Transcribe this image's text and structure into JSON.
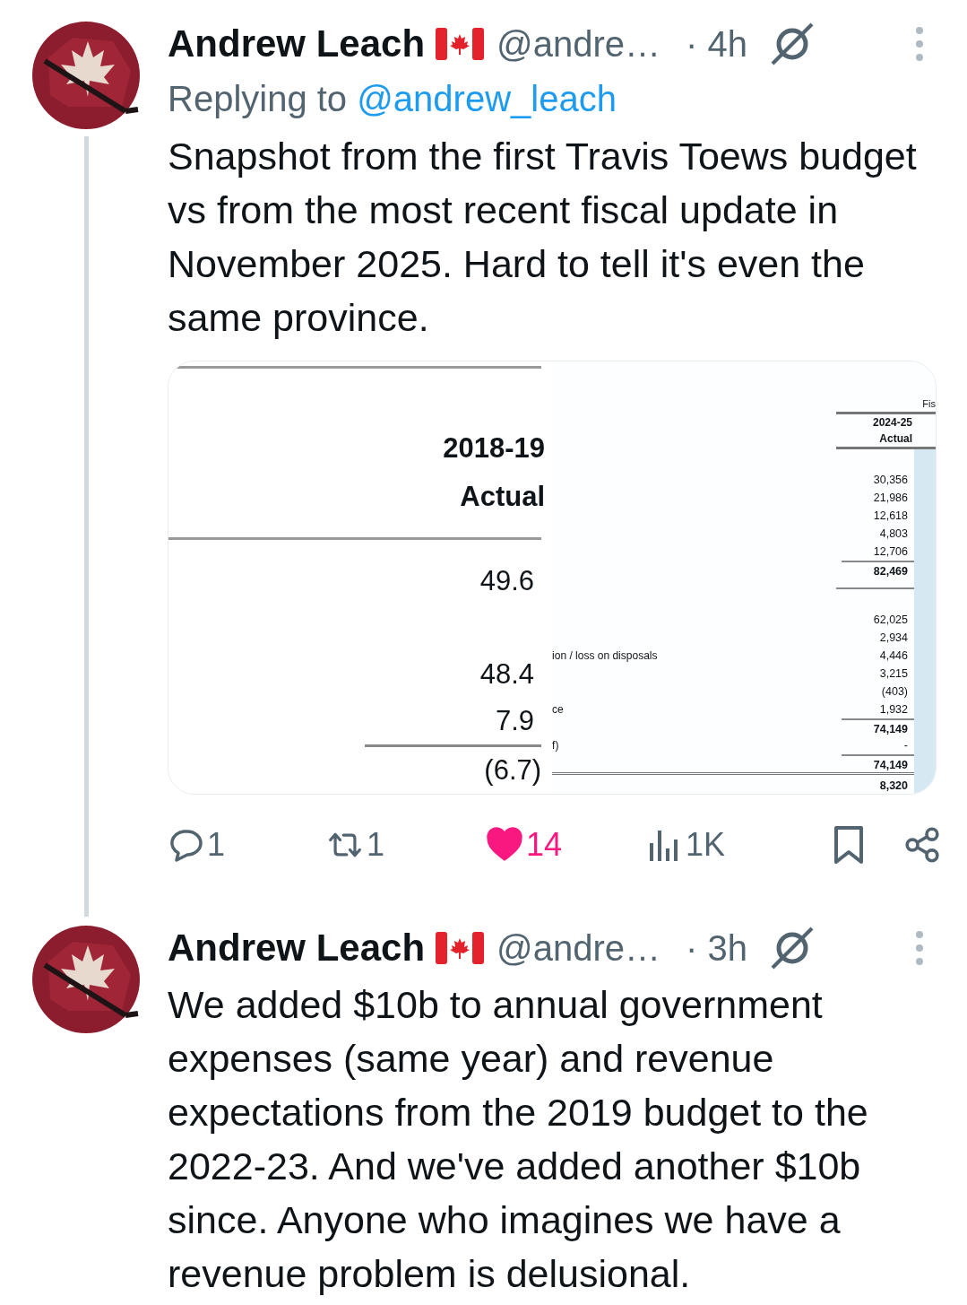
{
  "tweets": [
    {
      "author": "Andrew Leach",
      "handle": "@andre…",
      "time": "· 4h",
      "reply_prefix": "Replying to",
      "reply_handle": "@andrew_leach",
      "text": "Snapshot from the first Travis Toews budget vs from the most recent fiscal update in November 2025. Hard to tell it's even the same province.",
      "media": {
        "left": {
          "header": [
            "2018-19",
            "Actual"
          ],
          "values": [
            {
              "value": "49.6",
              "kind": "value"
            },
            {
              "kind": "blank"
            },
            {
              "value": "48.4",
              "kind": "value"
            },
            {
              "value": "7.9",
              "kind": "value"
            },
            {
              "value": "(6.7)",
              "kind": "total"
            }
          ]
        },
        "right": {
          "title": "Fis",
          "header": [
            "2024-25",
            "Actual"
          ],
          "rows": [
            {
              "kind": "blank"
            },
            {
              "kind": "value",
              "value": "30,356"
            },
            {
              "kind": "value",
              "value": "21,986"
            },
            {
              "kind": "value",
              "value": "12,618"
            },
            {
              "kind": "value",
              "value": "4,803"
            },
            {
              "kind": "value",
              "value": "12,706"
            },
            {
              "kind": "subtotal",
              "value": "82,469"
            },
            {
              "kind": "rule"
            },
            {
              "kind": "blank"
            },
            {
              "kind": "value",
              "value": "62,025"
            },
            {
              "kind": "value",
              "value": "2,934"
            },
            {
              "kind": "value",
              "label": "ion / loss on disposals",
              "value": "4,446"
            },
            {
              "kind": "value",
              "value": "3,215"
            },
            {
              "kind": "value",
              "value": "(403)"
            },
            {
              "kind": "value",
              "label": "ce",
              "value": "1,932"
            },
            {
              "kind": "subtotal",
              "value": "74,149"
            },
            {
              "kind": "value",
              "label": "f)",
              "value": "-"
            },
            {
              "kind": "subtotal",
              "value": "74,149"
            },
            {
              "kind": "grand_total",
              "value": "8,320"
            }
          ]
        }
      },
      "actions": [
        {
          "kind": "reply",
          "count": "1",
          "active": false
        },
        {
          "kind": "repost",
          "count": "1",
          "active": false
        },
        {
          "kind": "like",
          "count": "14",
          "active": true
        },
        {
          "kind": "views",
          "count": "1K",
          "active": false
        },
        {
          "kind": "bookmark",
          "active": false
        },
        {
          "kind": "share"
        }
      ]
    },
    {
      "author": "Andrew Leach",
      "handle": "@andre…",
      "time": "· 3h",
      "text": "We added $10b to annual government expenses (same year) and revenue expectations from the 2019 budget to the 2022-23. And we've added another $10b since. Anyone who imagines we have a revenue problem is delusional."
    }
  ]
}
